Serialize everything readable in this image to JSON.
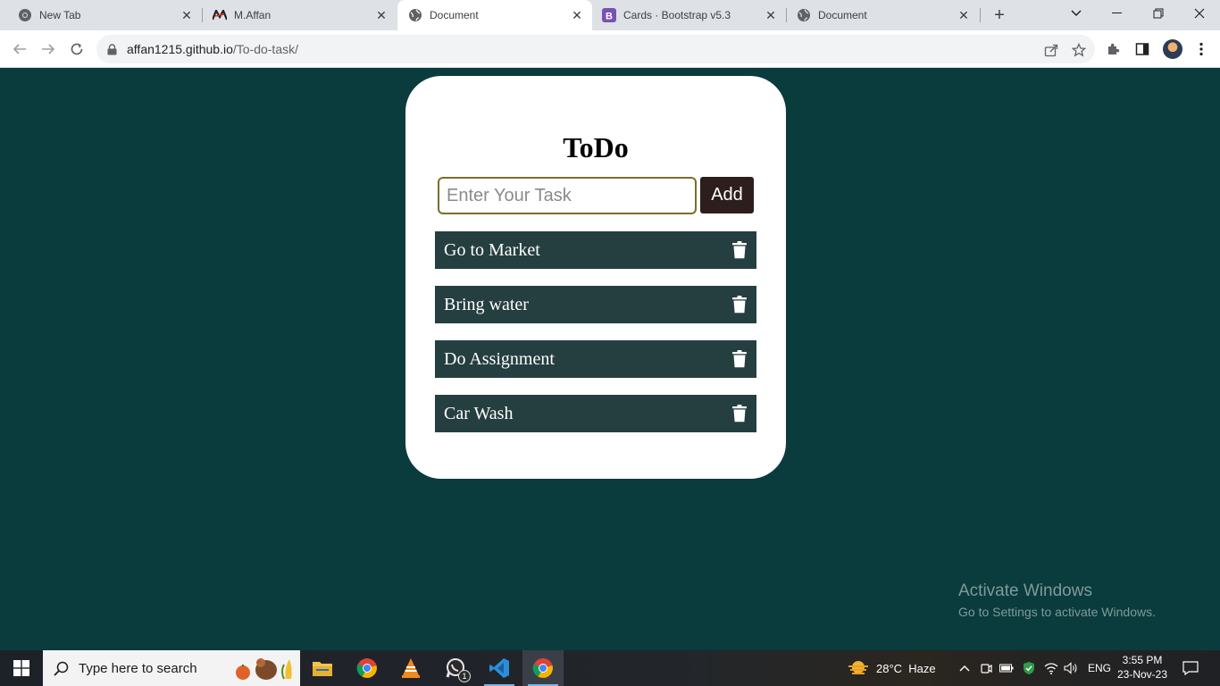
{
  "browser": {
    "tabs": [
      {
        "title": "New Tab",
        "icon": "chrome-icon"
      },
      {
        "title": "M.Affan",
        "icon": "ma-logo-icon"
      },
      {
        "title": "Document",
        "icon": "globe-icon",
        "active": true
      },
      {
        "title": "Cards · Bootstrap v5.3",
        "icon": "bootstrap-icon"
      },
      {
        "title": "Document",
        "icon": "globe-icon"
      }
    ],
    "url_host": "affan1215.github.io",
    "url_path": "/To-do-task/"
  },
  "page": {
    "title": "ToDo",
    "input_placeholder": "Enter Your Task",
    "add_label": "Add",
    "tasks": [
      "Go to Market",
      "Bring water",
      "Do Assignment",
      "Car Wash"
    ],
    "colors": {
      "background": "#0a3b3d",
      "task_bg": "#253f40",
      "add_btn": "#2e1d1d",
      "input_border": "#7a6f2a"
    }
  },
  "watermark": {
    "line1": "Activate Windows",
    "line2": "Go to Settings to activate Windows."
  },
  "taskbar": {
    "search_placeholder": "Type here to search",
    "weather_temp": "28°C",
    "weather_desc": "Haze",
    "lang": "ENG",
    "time": "3:55 PM",
    "date": "23-Nov-23",
    "whatsapp_badge": "1"
  }
}
